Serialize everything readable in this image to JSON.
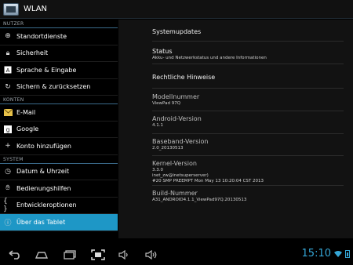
{
  "header": {
    "title": "WLAN",
    "icon": "settings-app-icon"
  },
  "sidebar": {
    "sections": [
      {
        "label": "NUTZER",
        "items": [
          {
            "label": "Standortdienste",
            "icon": "location-icon"
          },
          {
            "label": "Sicherheit",
            "icon": "lock-icon"
          },
          {
            "label": "Sprache & Eingabe",
            "icon": "language-icon"
          },
          {
            "label": "Sichern & zurücksetzen",
            "icon": "backup-icon"
          }
        ]
      },
      {
        "label": "KONTEN",
        "items": [
          {
            "label": "E-Mail",
            "icon": "email-icon"
          },
          {
            "label": "Google",
            "icon": "google-icon"
          },
          {
            "label": "Konto hinzufügen",
            "icon": "add-icon"
          }
        ]
      },
      {
        "label": "SYSTEM",
        "items": [
          {
            "label": "Datum & Uhrzeit",
            "icon": "clock-icon"
          },
          {
            "label": "Bedienungshilfen",
            "icon": "hand-icon"
          },
          {
            "label": "Entwickleroptionen",
            "icon": "braces-icon"
          },
          {
            "label": "Über das Tablet",
            "icon": "info-icon",
            "active": true
          }
        ]
      }
    ]
  },
  "detail": {
    "systemupdates": "Systemupdates",
    "status_title": "Status",
    "status_sub": "Akku- und Netzwerkstatus und andere Informationen",
    "legal": "Rechtliche Hinweise",
    "model_title": "Modellnummer",
    "model_value": "ViewPad 97Q",
    "android_title": "Android-Version",
    "android_value": "4.1.1",
    "baseband_title": "Baseband-Version",
    "baseband_value": "2.0_20130513",
    "kernel_title": "Kernel-Version",
    "kernel_line1": "3.3.0",
    "kernel_line2": "inet_zw@inetsuperserver)",
    "kernel_line3": "#20 SMP PREEMPT Mon May 13 10:20:04 CST 2013",
    "build_title": "Build-Nummer",
    "build_value": "A31_ANDROID4.1.1_ViewPad97Q.20130513"
  },
  "statusbar": {
    "time": "15:10",
    "accent": "#35a6d6"
  },
  "colors": {
    "active_item": "#1e97c6",
    "right_bg": "#121212"
  }
}
